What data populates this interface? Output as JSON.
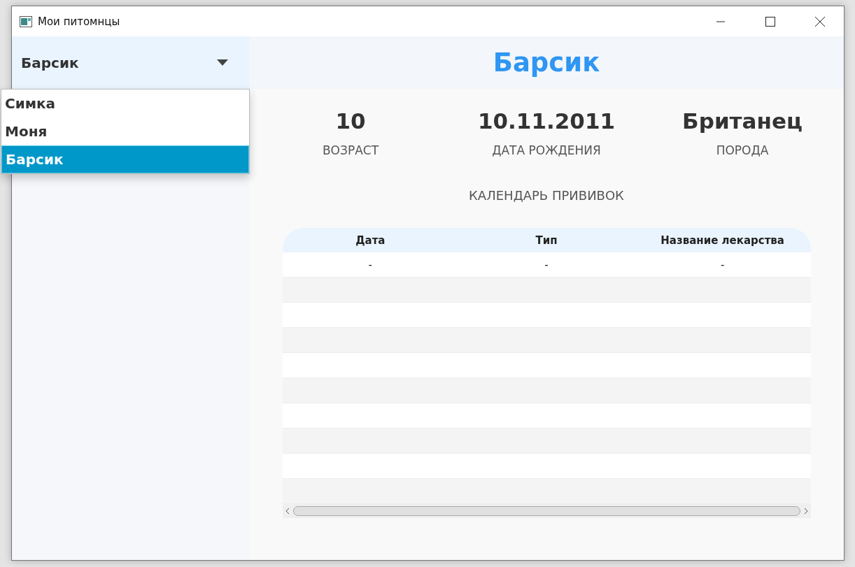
{
  "window": {
    "title": "Мои питомнцы"
  },
  "pet_select": {
    "value": "Барсик",
    "expanded": true,
    "options": [
      {
        "label": "Симка",
        "selected": false
      },
      {
        "label": "Моня",
        "selected": false
      },
      {
        "label": "Барсик",
        "selected": true
      }
    ]
  },
  "pet_name": "Барсик",
  "stats": [
    {
      "value": "10",
      "label": "ВОЗРАСТ"
    },
    {
      "value": "10.11.2011",
      "label": "ДАТА РОЖДЕНИЯ"
    },
    {
      "value": "Британец",
      "label": "ПОРОДА"
    }
  ],
  "calendar": {
    "title": "КАЛЕНДАРЬ ПРИВИВОК",
    "columns": [
      "Дата",
      "Тип",
      "Название лекарства"
    ],
    "rows": [
      [
        "-",
        "-",
        "-"
      ]
    ]
  }
}
